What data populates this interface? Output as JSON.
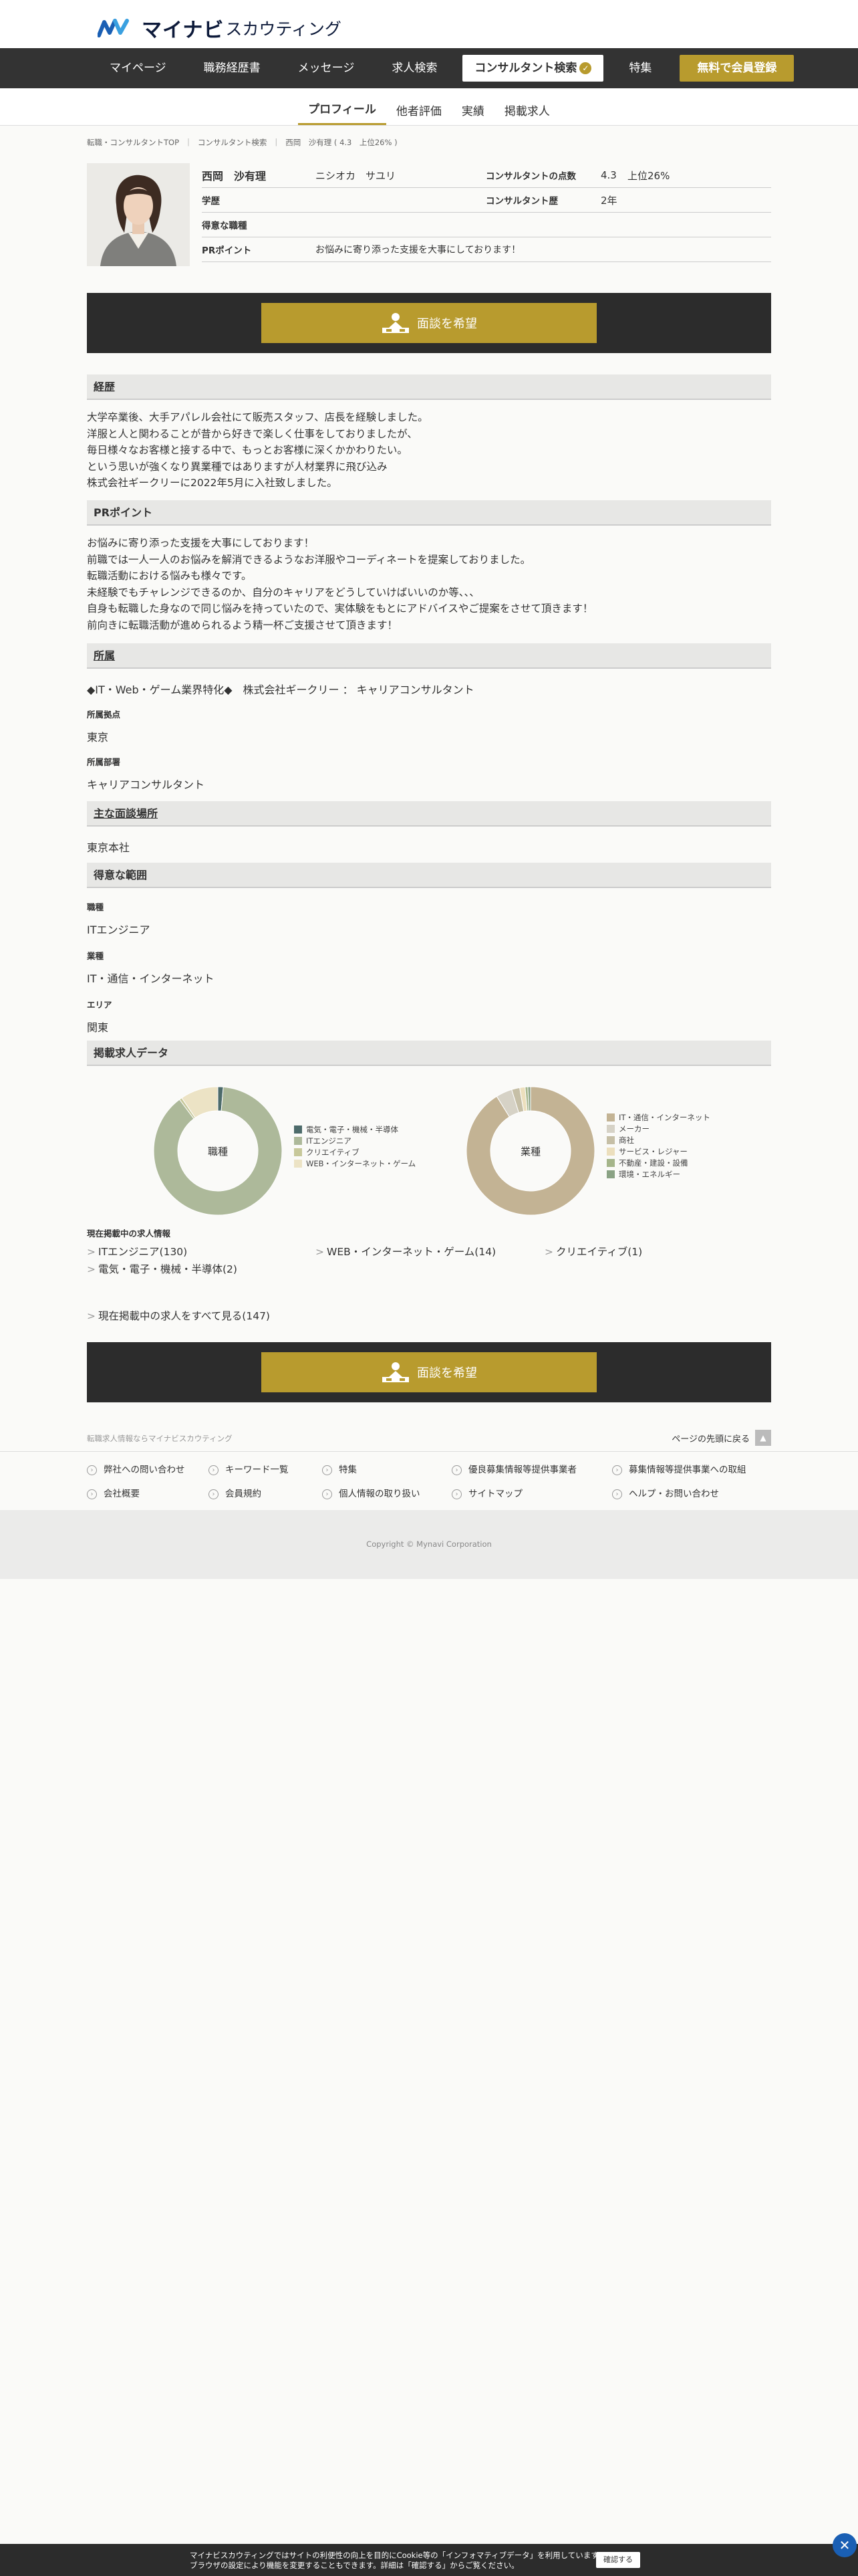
{
  "header": {
    "logo_main": "マイナビ",
    "logo_sub": "スカウティング"
  },
  "gnav": {
    "items": [
      "マイページ",
      "職務経歴書",
      "メッセージ",
      "求人検索"
    ],
    "active": "コンサルタント検索",
    "tokushu": "特集",
    "register": "無料で会員登録"
  },
  "subnav": {
    "tabs": [
      "プロフィール",
      "他者評価",
      "実績",
      "掲載求人"
    ]
  },
  "breadcrumb": [
    "転職・コンサルタントTOP",
    "コンサルタント検索",
    "西岡　沙有理 ( 4.3　上位26% )"
  ],
  "profile": {
    "name": "西岡　沙有理",
    "kana": "ニシオカ　サユリ",
    "score_label": "コンサルタントの点数",
    "score": "4.3",
    "rank": "上位26%",
    "edu_label": "学歴",
    "exp_label": "コンサルタント歴",
    "exp": "2年",
    "job_label": "得意な職種",
    "pr_label": "PRポイント",
    "pr": "お悩みに寄り添った支援を大事にしております！"
  },
  "cta": {
    "label": "面談を希望"
  },
  "career": {
    "title": "経歴",
    "lines": [
      "大学卒業後、大手アパレル会社にて販売スタッフ、店長を経験しました。",
      "洋服と人と関わることが昔から好きで楽しく仕事をしておりましたが、",
      "毎日様々なお客様と接する中で、もっとお客様に深くかかわりたい。",
      "という思いが強くなり異業種ではありますが人材業界に飛び込み",
      "株式会社ギークリーに2022年5月に入社致しました。"
    ]
  },
  "pr_section": {
    "title": "PRポイント",
    "lines": [
      "お悩みに寄り添った支援を大事にしております！",
      "前職では一人一人のお悩みを解消できるようなお洋服やコーディネートを提案しておりました。",
      "転職活動における悩みも様々です。",
      "未経験でもチャレンジできるのか、自分のキャリアをどうしていけばいいのか等、、、",
      "自身も転職した身なので同じ悩みを持っていたので、実体験をもとにアドバイスやご提案をさせて頂きます！",
      "前向きに転職活動が進められるよう精一杯ご支援させて頂きます！"
    ]
  },
  "affiliation": {
    "title": "所属",
    "company": "◆IT・Web・ゲーム業界特化◆　株式会社ギークリー ： キャリアコンサルタント",
    "base_label": "所属拠点",
    "base": "東京",
    "dept_label": "所属部署",
    "dept": "キャリアコンサルタント"
  },
  "meeting": {
    "title": "主な面談場所",
    "place": "東京本社"
  },
  "range": {
    "title": "得意な範囲",
    "job_label": "職種",
    "job": "ITエンジニア",
    "ind_label": "業種",
    "ind": "IT・通信・インターネット",
    "area_label": "エリア",
    "area": "関東"
  },
  "jobdata": {
    "title": "掲載求人データ",
    "donut1_label": "職種",
    "donut2_label": "業種",
    "current_title": "現在掲載中の求人情報",
    "jobs": [
      "ITエンジニア(130)",
      "WEB・インターネット・ゲーム(14)",
      "クリエイティブ(1)",
      "電気・電子・機械・半導体(2)"
    ],
    "see_all": "現在掲載中の求人をすべて見る(147)"
  },
  "chart_data": [
    {
      "type": "pie",
      "title": "職種",
      "labels": [
        "電気・電子・機械・半導体",
        "ITエンジニア",
        "クリエイティブ",
        "WEB・インターネット・ゲーム"
      ],
      "values": [
        2,
        130,
        1,
        14
      ],
      "colors": [
        "#4d6b6b",
        "#adb99a",
        "#c7c89a",
        "#ece3c5"
      ]
    },
    {
      "type": "pie",
      "title": "業種",
      "labels": [
        "IT・通信・インターネット",
        "メーカー",
        "商社",
        "サービス・レジャー",
        "不動産・建設・設備",
        "環境・エネルギー"
      ],
      "values": [
        134,
        6,
        3,
        2,
        1,
        1
      ],
      "colors": [
        "#c3b394",
        "#d6d2c6",
        "#c6bfa6",
        "#ecdfbd",
        "#a5b58a",
        "#8aa284"
      ]
    }
  ],
  "footer": {
    "tagline": "転職求人情報ならマイナビスカウティング",
    "totop": "ページの先頭に戻る",
    "links_row1": [
      "弊社への問い合わせ",
      "キーワード一覧",
      "特集",
      "優良募集情報等提供事業者",
      "募集情報等提供事業への取組"
    ],
    "links_row2": [
      "会社概要",
      "会員規約",
      "個人情報の取り扱い",
      "サイトマップ",
      "ヘルプ・お問い合わせ"
    ],
    "copyright": "Copyright © Mynavi Corporation"
  },
  "cookie": {
    "line1": "マイナビスカウティングではサイトの利便性の向上を目的にCookie等の「インフォマティブデータ」を利用しています。",
    "line2": "ブラウザの設定により機能を変更することもできます。詳細は「確認する」からご覧ください。",
    "button": "確認する"
  }
}
